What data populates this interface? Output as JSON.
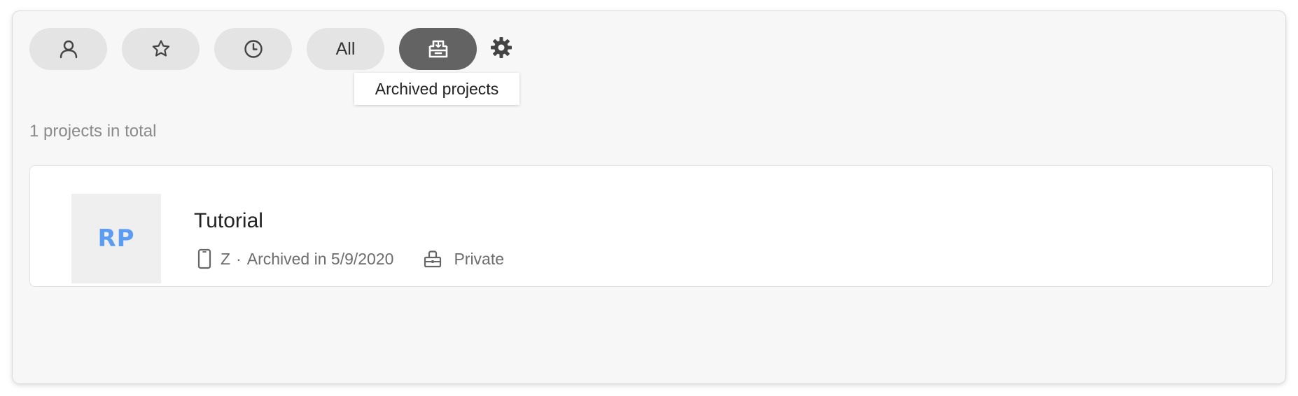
{
  "filters": {
    "mine_icon": "person-icon",
    "starred_icon": "star-icon",
    "recent_icon": "clock-icon",
    "all_label": "All",
    "archived_icon": "archive-box-icon",
    "settings_icon": "gear-icon",
    "active": "archived"
  },
  "tooltip": {
    "text": "Archived projects"
  },
  "summary": {
    "total_text": "1 projects in total"
  },
  "projects": [
    {
      "initials": "RP",
      "name": "Tutorial",
      "device_icon": "phone-icon",
      "owner": "Z",
      "separator": "·",
      "status": "Archived in 5/9/2020",
      "privacy_icon": "lock-icon",
      "privacy": "Private"
    }
  ],
  "colors": {
    "accent": "#5b9df5",
    "active_pill": "#636363",
    "pill": "#e4e4e4",
    "background": "#f7f7f7"
  }
}
